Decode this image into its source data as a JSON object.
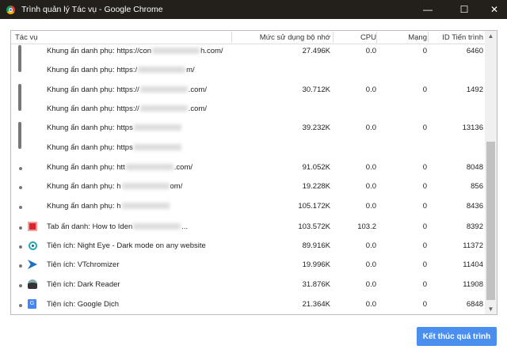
{
  "window": {
    "title": "Trình quản lý Tác vụ - Google Chrome",
    "minimize": "—",
    "maximize": "☐",
    "close": "✕"
  },
  "columns": {
    "task": "Tác vụ",
    "memory": "Mức sử dụng bộ nhớ",
    "cpu": "CPU",
    "network": "Mạng",
    "pid": "ID Tiến trình"
  },
  "rows": [
    {
      "name": "Khung ẩn danh phụ: https://con",
      "suffix": "h.com/",
      "memory": "27.496K",
      "cpu": "0.0",
      "network": "0",
      "pid": "6460",
      "icon": "none"
    },
    {
      "name": "Khung ẩn danh phụ: https:/",
      "suffix": "m/",
      "memory": "",
      "cpu": "",
      "network": "",
      "pid": "",
      "icon": "none"
    },
    {
      "name": "Khung ẩn danh phụ: https://",
      "suffix": ".com/",
      "memory": "30.712K",
      "cpu": "0.0",
      "network": "0",
      "pid": "1492",
      "icon": "none"
    },
    {
      "name": "Khung ẩn danh phụ: https://",
      "suffix": ".com/",
      "memory": "",
      "cpu": "",
      "network": "",
      "pid": "",
      "icon": "none"
    },
    {
      "name": "Khung ẩn danh phụ: https",
      "suffix": "",
      "memory": "39.232K",
      "cpu": "0.0",
      "network": "0",
      "pid": "13136",
      "icon": "none"
    },
    {
      "name": "Khung ẩn danh phụ: https",
      "suffix": "",
      "memory": "",
      "cpu": "",
      "network": "",
      "pid": "",
      "icon": "none"
    },
    {
      "name": "Khung ẩn danh phụ: htt",
      "suffix": ".com/",
      "memory": "91.052K",
      "cpu": "0.0",
      "network": "0",
      "pid": "8048",
      "icon": "none"
    },
    {
      "name": "Khung ẩn danh phụ: h",
      "suffix": "om/",
      "memory": "19.228K",
      "cpu": "0.0",
      "network": "0",
      "pid": "856",
      "icon": "none"
    },
    {
      "name": "Khung ẩn danh phụ: h",
      "suffix": "",
      "memory": "105.172K",
      "cpu": "0.0",
      "network": "0",
      "pid": "8436",
      "icon": "none"
    },
    {
      "name": "Tab ẩn danh: How to Iden",
      "suffix": "...",
      "memory": "103.572K",
      "cpu": "103.2",
      "network": "0",
      "pid": "8392",
      "icon": "site-icon"
    },
    {
      "name": "Tiện ích: Night Eye - Dark mode on any website",
      "suffix": "",
      "memory": "89.916K",
      "cpu": "0.0",
      "network": "0",
      "pid": "11372",
      "icon": "night-eye-icon"
    },
    {
      "name": "Tiện ích: VTchromizer",
      "suffix": "",
      "memory": "19.996K",
      "cpu": "0.0",
      "network": "0",
      "pid": "11404",
      "icon": "vtchromizer-icon"
    },
    {
      "name": "Tiện ích: Dark Reader",
      "suffix": "",
      "memory": "31.876K",
      "cpu": "0.0",
      "network": "0",
      "pid": "11908",
      "icon": "dark-reader-icon"
    },
    {
      "name": "Tiện ích: Google Dịch",
      "suffix": "",
      "memory": "21.364K",
      "cpu": "0.0",
      "network": "0",
      "pid": "6848",
      "icon": "google-translate-icon"
    }
  ],
  "end_process_button": "Kết thúc quá trình",
  "colors": {
    "titlebar": "#231f1a",
    "accent": "#4a8ef0"
  }
}
